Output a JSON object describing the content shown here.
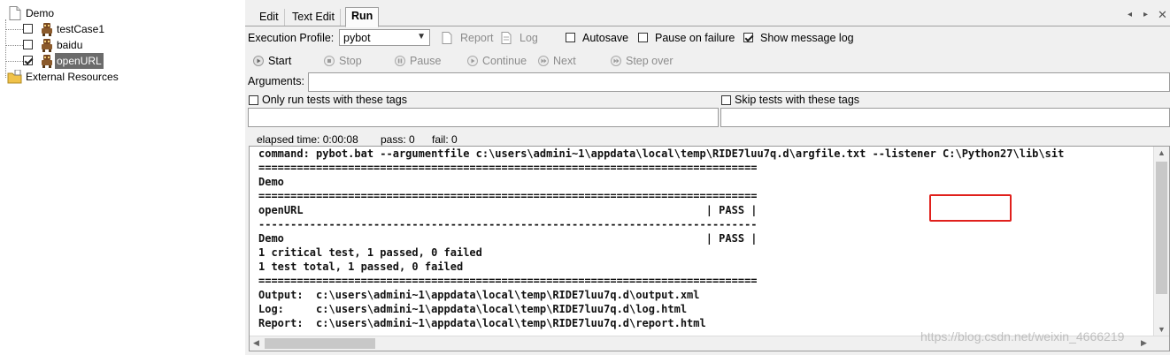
{
  "tree": {
    "root": "Demo",
    "tests": [
      {
        "label": "testCase1",
        "checked": false,
        "selected": false
      },
      {
        "label": "baidu",
        "checked": false,
        "selected": false
      },
      {
        "label": "openURL",
        "checked": true,
        "selected": true
      }
    ],
    "external": "External Resources"
  },
  "tabs": [
    "Edit",
    "Text Edit",
    "Run"
  ],
  "profile": {
    "label": "Execution Profile:",
    "value": "pybot",
    "report": "Report",
    "log": "Log",
    "autosave": "Autosave",
    "pause_on_failure": "Pause on failure",
    "show_message_log": "Show message log"
  },
  "controls": {
    "start": "Start",
    "stop": "Stop",
    "pause": "Pause",
    "continue": "Continue",
    "next": "Next",
    "step_over": "Step over"
  },
  "arguments_label": "Arguments:",
  "tags": {
    "only_run": "Only run tests with these tags",
    "skip": "Skip tests with these tags"
  },
  "status": {
    "elapsed": "elapsed time: 0:00:08",
    "pass": "pass: 0",
    "fail": "fail: 0"
  },
  "console_lines": [
    "command: pybot.bat --argumentfile c:\\users\\admini~1\\appdata\\local\\temp\\RIDE7luu7q.d\\argfile.txt --listener C:\\Python27\\lib\\sit",
    "==============================================================================",
    "Demo",
    "==============================================================================",
    "openURL                                                               | PASS |",
    "------------------------------------------------------------------------------",
    "Demo                                                                  | PASS |",
    "1 critical test, 1 passed, 0 failed",
    "1 test total, 1 passed, 0 failed",
    "==============================================================================",
    "Output:  c:\\users\\admini~1\\appdata\\local\\temp\\RIDE7luu7q.d\\output.xml",
    "Log:     c:\\users\\admini~1\\appdata\\local\\temp\\RIDE7luu7q.d\\log.html",
    "Report:  c:\\users\\admini~1\\appdata\\local\\temp\\RIDE7luu7q.d\\report.html"
  ],
  "watermark": "https://blog.csdn.net/weixin_4666219"
}
